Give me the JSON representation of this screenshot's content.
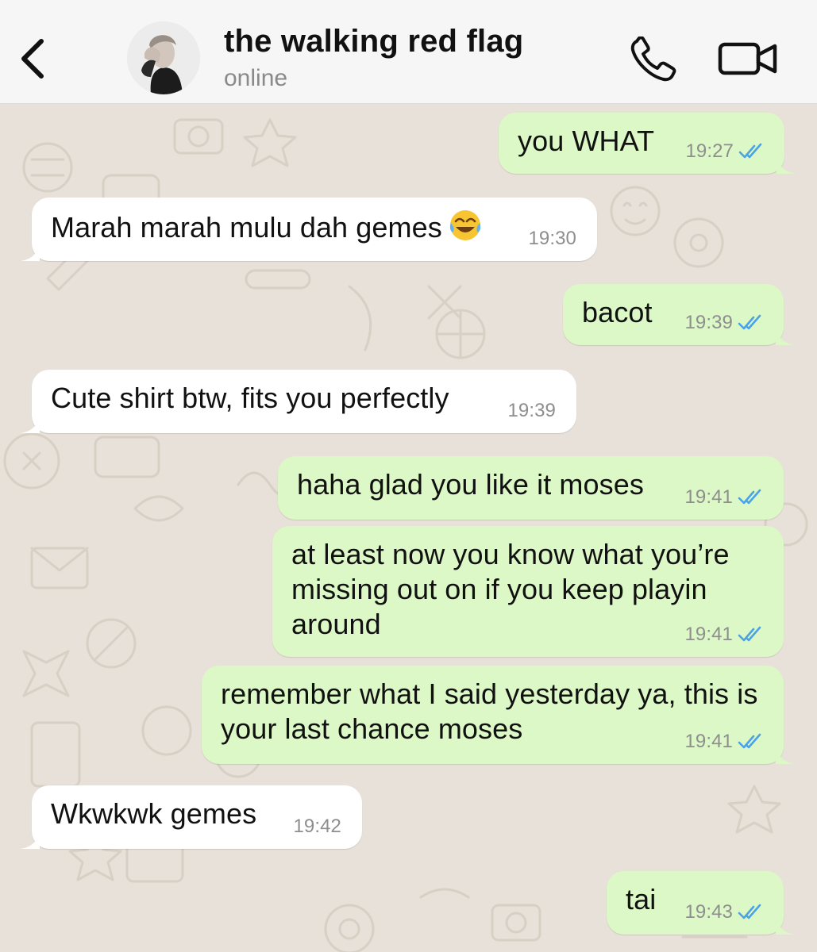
{
  "header": {
    "contact_name": "the walking red flag",
    "status": "online"
  },
  "messages": [
    {
      "direction": "outgoing",
      "text": "you WHAT",
      "time": "19:27",
      "read": true
    },
    {
      "direction": "incoming",
      "text": "Marah marah mulu dah gemes",
      "emoji": "face-with-tears-of-joy",
      "time": "19:30"
    },
    {
      "direction": "outgoing",
      "text": "bacot",
      "time": "19:39",
      "read": true
    },
    {
      "direction": "incoming",
      "text": "Cute shirt btw, fits you perfectly",
      "time": "19:39"
    },
    {
      "direction": "outgoing",
      "text": "haha glad you like it moses",
      "time": "19:41",
      "read": true
    },
    {
      "direction": "outgoing",
      "text": "at least now you know what you’re missing out on if you keep playin around",
      "time": "19:41",
      "read": true
    },
    {
      "direction": "outgoing",
      "text": "remember what I said yesterday ya, this is your last chance moses",
      "time": "19:41",
      "read": true
    },
    {
      "direction": "incoming",
      "text": "Wkwkwk gemes",
      "time": "19:42"
    },
    {
      "direction": "outgoing",
      "text": "tai",
      "time": "19:43",
      "read": true
    }
  ],
  "colors": {
    "outgoing_bubble": "#dcf8c6",
    "incoming_bubble": "#ffffff",
    "read_ticks": "#4aa3e8",
    "chat_background": "#e8e1d9"
  }
}
